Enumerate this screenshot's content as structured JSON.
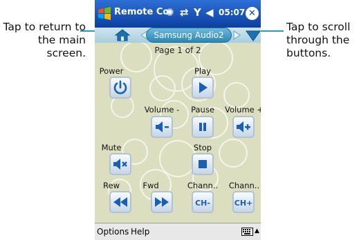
{
  "callouts": {
    "left": "Tap to return to the main screen.",
    "right": "Tap to scroll through the buttons."
  },
  "titlebar": {
    "title": "Remote Co",
    "time": "05:07",
    "icons": [
      "windows-start-icon",
      "remote-icon",
      "connectivity-icon",
      "signal-icon",
      "volume-icon",
      "close-icon"
    ]
  },
  "navbar": {
    "device": "Samsung Audio2"
  },
  "page": {
    "label": "Page 1 of 2"
  },
  "buttons": {
    "power": "Power",
    "play": "Play",
    "volume_down": "Volume -",
    "pause": "Pause",
    "volume_up": "Volume +",
    "mute": "Mute",
    "stop": "Stop",
    "rew": "Rew",
    "fwd": "Fwd",
    "channel_down": "Chann..",
    "channel_up": "Chann..",
    "ch_minus_text": "CH-",
    "ch_plus_text": "CH+"
  },
  "menubar": {
    "options": "Options",
    "help": "Help"
  },
  "colors": {
    "titlebar": "#0b3f9e",
    "accent": "#1a5fb4",
    "callout_line": "#2a9bb3",
    "background": "#dcdfbf"
  }
}
